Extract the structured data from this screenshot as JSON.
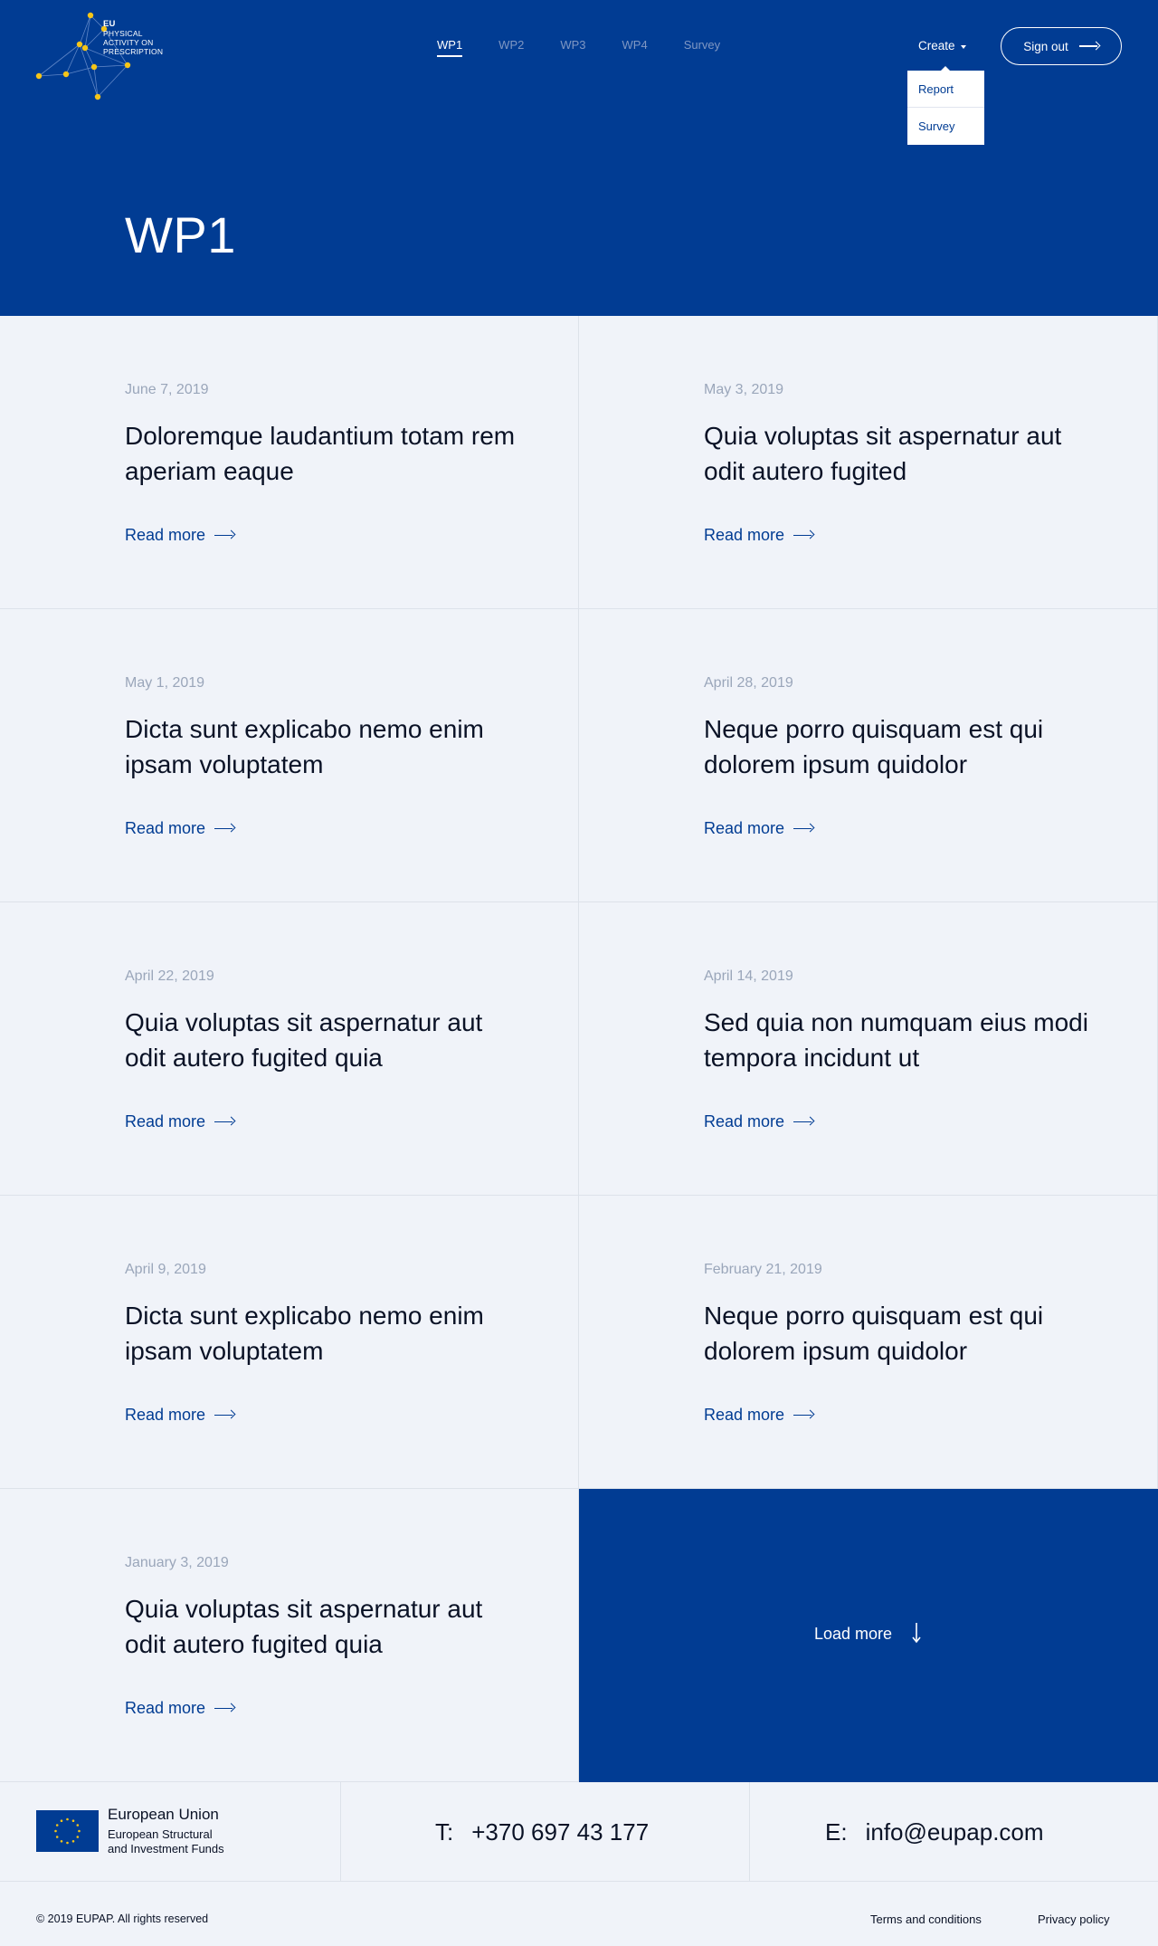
{
  "logo": {
    "line1": "EU",
    "line2": "PHYSICAL",
    "line3": "ACTIVITY ON",
    "line4": "PRESCRIPTION"
  },
  "nav": {
    "items": [
      {
        "label": "WP1",
        "active": true
      },
      {
        "label": "WP2",
        "active": false
      },
      {
        "label": "WP3",
        "active": false
      },
      {
        "label": "WP4",
        "active": false
      },
      {
        "label": "Survey",
        "active": false
      }
    ]
  },
  "header": {
    "create_label": "Create",
    "dropdown": [
      "Report",
      "Survey"
    ],
    "signout_label": "Sign out"
  },
  "page": {
    "title": "WP1"
  },
  "articles": [
    {
      "date": "June 7, 2019",
      "title": "Doloremque laudantium totam rem aperiam eaque",
      "link": "Read more"
    },
    {
      "date": "May 3, 2019",
      "title": "Quia voluptas sit aspernatur aut odit autero fugited",
      "link": "Read more"
    },
    {
      "date": "May 1, 2019",
      "title": "Dicta sunt explicabo nemo enim ipsam voluptatem",
      "link": "Read more"
    },
    {
      "date": "April 28, 2019",
      "title": "Neque porro quisquam est qui dolorem ipsum quidolor",
      "link": "Read more"
    },
    {
      "date": "April 22, 2019",
      "title": "Quia voluptas sit aspernatur aut odit autero fugited quia",
      "link": "Read more"
    },
    {
      "date": "April 14, 2019",
      "title": "Sed quia non numquam eius modi tempora incidunt ut",
      "link": "Read more"
    },
    {
      "date": "April 9, 2019",
      "title": "Dicta sunt explicabo nemo enim ipsam voluptatem",
      "link": "Read more"
    },
    {
      "date": "February 21, 2019",
      "title": "Neque porro quisquam est qui dolorem ipsum quidolor",
      "link": "Read more"
    },
    {
      "date": "January 3, 2019",
      "title": "Quia voluptas sit aspernatur aut odit autero fugited quia",
      "link": "Read more"
    }
  ],
  "load_more": {
    "label": "Load more"
  },
  "footer": {
    "eu_title": "European Union",
    "eu_sub1": "European Structural",
    "eu_sub2": "and Investment Funds",
    "phone_key": "T:",
    "phone": "+370 697 43 177",
    "email_key": "E:",
    "email": "info@eupap.com",
    "copyright": "© 2019 EUPAP. All rights reserved",
    "terms": "Terms and conditions",
    "privacy": "Privacy policy"
  },
  "colors": {
    "brand_blue": "#013c93",
    "background": "#f0f3f9",
    "logo_dot": "#f5c518"
  }
}
